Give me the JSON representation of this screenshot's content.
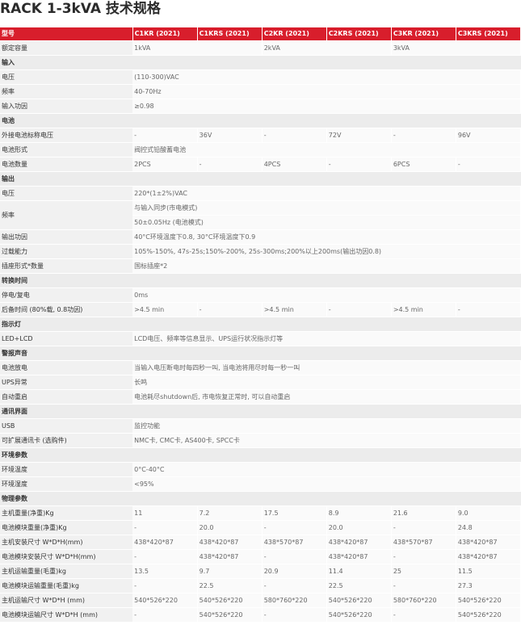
{
  "title": "RACK 1-3kVA 技术规格",
  "header": {
    "label": "型号",
    "models": [
      "C1KR (2021)",
      "C1KRS (2021)",
      "C2KR (2021)",
      "C2KRS (2021)",
      "C3KR (2021)",
      "C3KRS (2021)"
    ]
  },
  "rows": [
    {
      "type": "row",
      "label": "额定容量",
      "cells": [
        {
          "v": "1kVA",
          "span": 2
        },
        {
          "v": "2kVA",
          "span": 2
        },
        {
          "v": "3kVA",
          "span": 2
        }
      ]
    },
    {
      "type": "sec",
      "label": "输入"
    },
    {
      "type": "row",
      "label": "电压",
      "cells": [
        {
          "v": "(110-300)VAC",
          "span": 6
        }
      ]
    },
    {
      "type": "row",
      "label": "频率",
      "cells": [
        {
          "v": "40-70Hz",
          "span": 6
        }
      ]
    },
    {
      "type": "row",
      "label": "输入功因",
      "cells": [
        {
          "v": "≥0.98",
          "span": 6
        }
      ]
    },
    {
      "type": "sec",
      "label": "电池"
    },
    {
      "type": "row",
      "label": "外接电池标称电压",
      "cells": [
        {
          "v": "-"
        },
        {
          "v": "36V"
        },
        {
          "v": "-"
        },
        {
          "v": "72V"
        },
        {
          "v": "-"
        },
        {
          "v": "96V"
        }
      ]
    },
    {
      "type": "row",
      "label": "电池形式",
      "cells": [
        {
          "v": "阀控式铅酸蓄电池",
          "span": 6
        }
      ]
    },
    {
      "type": "row",
      "label": "电池数量",
      "cells": [
        {
          "v": "2PCS"
        },
        {
          "v": "-"
        },
        {
          "v": "4PCS"
        },
        {
          "v": "-"
        },
        {
          "v": "6PCS"
        },
        {
          "v": "-"
        }
      ]
    },
    {
      "type": "sec",
      "label": "输出"
    },
    {
      "type": "row",
      "label": "电压",
      "cells": [
        {
          "v": "220*(1±2%)VAC",
          "span": 6
        }
      ]
    },
    {
      "type": "row",
      "label": "频率",
      "tall": true,
      "cells": [
        {
          "lines": [
            "与输入同步(市电模式)",
            "50±0.05Hz (电池模式)"
          ],
          "span": 6
        }
      ]
    },
    {
      "type": "row",
      "label": "输出功因",
      "cells": [
        {
          "v": "40°C环境温度下0.8, 30°C环境温度下0.9",
          "span": 6
        }
      ]
    },
    {
      "type": "row",
      "label": "过载能力",
      "cells": [
        {
          "v": "105%-150%, 47s-25s;150%-200%, 25s-300ms;200%以上200ms(输出功因0.8)",
          "span": 6
        }
      ]
    },
    {
      "type": "row",
      "label": "插座形式*数量",
      "cells": [
        {
          "v": "国标插座*2",
          "span": 6
        }
      ]
    },
    {
      "type": "sec",
      "label": "转换时间"
    },
    {
      "type": "row",
      "label": "停电/复电",
      "cells": [
        {
          "v": "0ms",
          "span": 6
        }
      ]
    },
    {
      "type": "row",
      "label": "后备时间 (80%载, 0.8功因)",
      "cells": [
        {
          "v": ">4.5 min"
        },
        {
          "v": "-"
        },
        {
          "v": ">4.5 min"
        },
        {
          "v": "-"
        },
        {
          "v": ">4.5 min"
        },
        {
          "v": "-"
        }
      ]
    },
    {
      "type": "sec",
      "label": "指示灯"
    },
    {
      "type": "row",
      "label": "LED+LCD",
      "cells": [
        {
          "v": "LCD电压、频率等信息显示、UPS运行状况指示灯等",
          "span": 6
        }
      ]
    },
    {
      "type": "sec",
      "label": "警报声音"
    },
    {
      "type": "row",
      "label": "电池放电",
      "cells": [
        {
          "v": "当输入电压断电时每四秒一叫, 当电池将用尽时每一秒一叫",
          "span": 6
        }
      ]
    },
    {
      "type": "row",
      "label": "UPS异常",
      "cells": [
        {
          "v": "长鸣",
          "span": 6
        }
      ]
    },
    {
      "type": "row",
      "label": "自动重启",
      "cells": [
        {
          "v": "电池耗尽shutdown后, 市电恢复正常时, 可以自动重启",
          "span": 6
        }
      ]
    },
    {
      "type": "sec",
      "label": "通讯界面"
    },
    {
      "type": "row",
      "label": "USB",
      "cells": [
        {
          "v": "监控功能",
          "span": 6
        }
      ]
    },
    {
      "type": "row",
      "label": "可扩展通讯卡 (选购件)",
      "cells": [
        {
          "v": "NMC卡, CMC卡, AS400卡, SPCC卡",
          "span": 6
        }
      ]
    },
    {
      "type": "sec",
      "label": "环境参数"
    },
    {
      "type": "row",
      "label": "环境温度",
      "cells": [
        {
          "v": "0°C-40°C",
          "span": 6
        }
      ]
    },
    {
      "type": "row",
      "label": "环境湿度",
      "cells": [
        {
          "v": "<95%",
          "span": 6
        }
      ]
    },
    {
      "type": "sec",
      "label": "物理参数"
    },
    {
      "type": "row",
      "label": "主机重量(净重)Kg",
      "cells": [
        {
          "v": "11"
        },
        {
          "v": "7.2"
        },
        {
          "v": "17.5"
        },
        {
          "v": "8.9"
        },
        {
          "v": "21.6"
        },
        {
          "v": "9.0"
        }
      ]
    },
    {
      "type": "row",
      "label": "电池模块重量(净重)Kg",
      "cells": [
        {
          "v": "-"
        },
        {
          "v": "20.0"
        },
        {
          "v": "-"
        },
        {
          "v": "20.0"
        },
        {
          "v": "-"
        },
        {
          "v": "24.8"
        }
      ]
    },
    {
      "type": "row",
      "label": "主机安装尺寸 W*D*H(mm)",
      "cells": [
        {
          "v": "438*420*87"
        },
        {
          "v": "438*420*87"
        },
        {
          "v": "438*570*87"
        },
        {
          "v": "438*420*87"
        },
        {
          "v": "438*570*87"
        },
        {
          "v": "438*420*87"
        }
      ]
    },
    {
      "type": "row",
      "label": "电池模块安装尺寸 W*D*H(mm)",
      "cells": [
        {
          "v": "-"
        },
        {
          "v": "438*420*87"
        },
        {
          "v": "-"
        },
        {
          "v": "438*420*87"
        },
        {
          "v": "-"
        },
        {
          "v": "438*420*87"
        }
      ]
    },
    {
      "type": "row",
      "label": "主机运输重量(毛重)kg",
      "cells": [
        {
          "v": "13.5"
        },
        {
          "v": "9.7"
        },
        {
          "v": "20.9"
        },
        {
          "v": "11.4"
        },
        {
          "v": "25"
        },
        {
          "v": "11.5"
        }
      ]
    },
    {
      "type": "row",
      "label": "电池模块运输重量(毛重)kg",
      "cells": [
        {
          "v": "-"
        },
        {
          "v": "22.5"
        },
        {
          "v": "-"
        },
        {
          "v": "22.5"
        },
        {
          "v": "-"
        },
        {
          "v": "27.3"
        }
      ]
    },
    {
      "type": "row",
      "label": "主机运输尺寸 W*D*H (mm)",
      "cells": [
        {
          "v": "540*526*220"
        },
        {
          "v": "540*526*220"
        },
        {
          "v": "580*760*220"
        },
        {
          "v": "540*526*220"
        },
        {
          "v": "580*760*220"
        },
        {
          "v": "540*526*220"
        }
      ]
    },
    {
      "type": "row",
      "label": "电池模块运输尺寸 W*D*H (mm)",
      "cells": [
        {
          "v": "-"
        },
        {
          "v": "540*526*220"
        },
        {
          "v": "-"
        },
        {
          "v": "540*526*220"
        },
        {
          "v": "-"
        },
        {
          "v": "540*526*220"
        }
      ]
    }
  ]
}
